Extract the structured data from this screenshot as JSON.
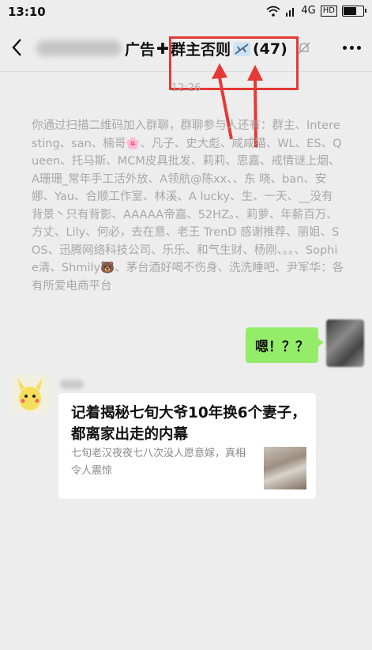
{
  "status_bar": {
    "time": "13:10",
    "network": "4G",
    "hd": "HD"
  },
  "title_bar": {
    "title_part1": "广告",
    "title_plus": "✚",
    "title_part2": "群主否则",
    "member_count": "(47)"
  },
  "chat": {
    "timestamp": "12:26",
    "system_message": "你通过扫描二维码加入群聊，群聊参与人还有：群主、Interesting、san、楠哥🌸、凡子、史大彪、咸咸猫、WL、ES、Queen、托马斯、MCM皮具批发、莉莉、思嘉、戒情谜上烟、A珊珊_常年手工活外放、A领航@陈xx、、东 晓、ban、安娜、Yau、合顺工作室、林溪、A lucky、生、一天、__没有背景丶只有背影、AAAAA帝嘉、52HZ。、莉萝、年薪百万、方丈、Lily、何必，去在意、老王 TrenD 感谢推荐、丽姐、SOS、迅腾网络科技公司、乐乐、和气生财、杨刚、。。、Sophie清、Shmily🐻、茅台酒好喝不伤身、洗洗睡吧、尹军华：各有所爱电商平台",
    "my_message": "嗯！？？",
    "card": {
      "title": "记着揭秘七旬大爷10年换6个妻子，都离家出走的内幕",
      "description": "七旬老汉夜夜七八次没人愿意嫁，真相令人震惊"
    }
  },
  "colors": {
    "accent_green": "#95ec69",
    "highlight_red": "#e53935",
    "background": "#ededed"
  }
}
